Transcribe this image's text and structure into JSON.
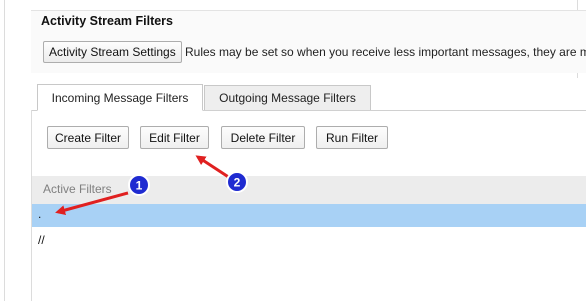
{
  "section": {
    "title": "Activity Stream Filters",
    "settings_button": "Activity Stream Settings",
    "rules_text": "Rules may be set so when you receive less important messages, they are mo"
  },
  "tabs": [
    {
      "label": "Incoming Message Filters",
      "active": true
    },
    {
      "label": "Outgoing Message Filters",
      "active": false
    }
  ],
  "toolbar": {
    "create": "Create Filter",
    "edit": "Edit Filter",
    "delete": "Delete Filter",
    "run": "Run Filter"
  },
  "filters_list": {
    "header": "Active Filters",
    "rows": [
      {
        "text": ".",
        "selected": true
      },
      {
        "text": "//",
        "selected": false
      }
    ]
  },
  "annotations": [
    {
      "number": "1",
      "color": "#1f2bd1"
    },
    {
      "number": "2",
      "color": "#1f2bd1"
    }
  ],
  "colors": {
    "arrow": "#e02020",
    "selection": "#a8d1f5",
    "badge": "#1f2bd1"
  }
}
